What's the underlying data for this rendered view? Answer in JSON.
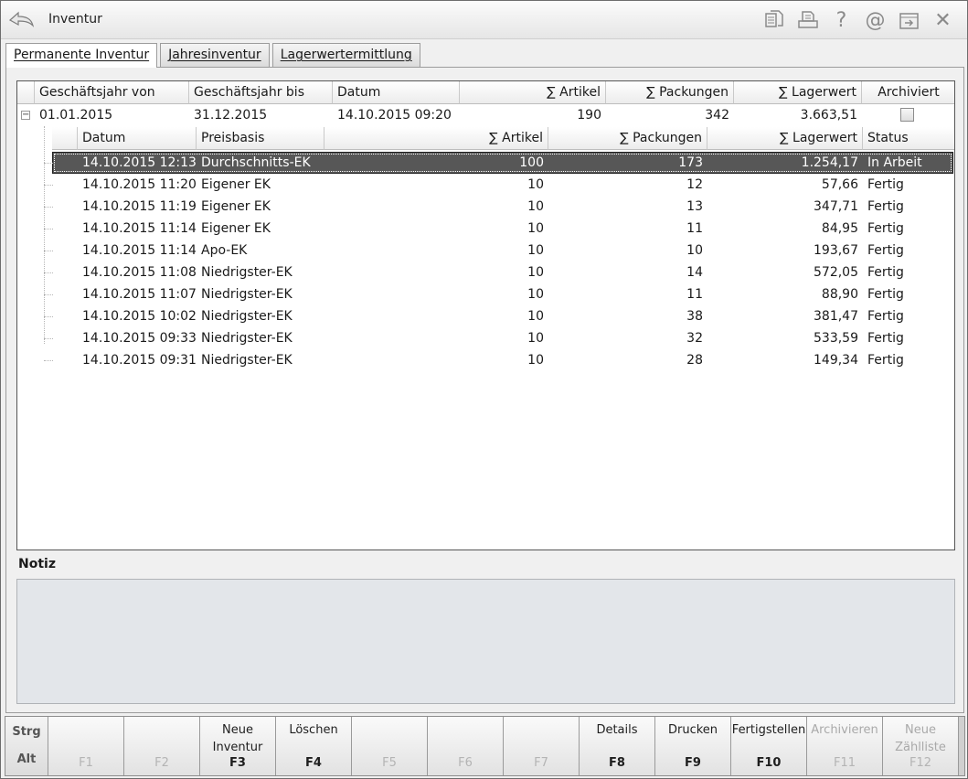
{
  "window": {
    "title": "Inventur"
  },
  "toolbar": {
    "icons": [
      "copy-icon",
      "print-icon",
      "help-icon",
      "at-icon",
      "export-icon",
      "close-icon"
    ],
    "help_glyph": "?",
    "at_glyph": "@",
    "close_glyph": "✕"
  },
  "tabs": [
    {
      "label": "Permanente Inventur",
      "active": true
    },
    {
      "label": "Jahresinventur",
      "active": false
    },
    {
      "label": "Lagerwertermittlung",
      "active": false
    }
  ],
  "main_grid": {
    "columns": [
      "Geschäftsjahr von",
      "Geschäftsjahr bis",
      "Datum",
      "∑ Artikel",
      "∑ Packungen",
      "∑ Lagerwert",
      "Archiviert"
    ],
    "row": {
      "expander": "−",
      "von": "01.01.2015",
      "bis": "31.12.2015",
      "datum": "14.10.2015 09:20",
      "artikel": "190",
      "packungen": "342",
      "lagerwert": "3.663,51",
      "archiviert": false
    }
  },
  "sub_grid": {
    "columns": [
      "Datum",
      "Preisbasis",
      "∑ Artikel",
      "∑ Packungen",
      "∑ Lagerwert",
      "Status"
    ],
    "rows": [
      {
        "datum": "14.10.2015 12:13",
        "preisbasis": "Durchschnitts-EK",
        "artikel": "100",
        "packungen": "173",
        "lagerwert": "1.254,17",
        "status": "In Arbeit",
        "selected": true
      },
      {
        "datum": "14.10.2015 11:20",
        "preisbasis": "Eigener EK",
        "artikel": "10",
        "packungen": "12",
        "lagerwert": "57,66",
        "status": "Fertig"
      },
      {
        "datum": "14.10.2015 11:19",
        "preisbasis": "Eigener EK",
        "artikel": "10",
        "packungen": "13",
        "lagerwert": "347,71",
        "status": "Fertig"
      },
      {
        "datum": "14.10.2015 11:14",
        "preisbasis": "Eigener EK",
        "artikel": "10",
        "packungen": "11",
        "lagerwert": "84,95",
        "status": "Fertig"
      },
      {
        "datum": "14.10.2015 11:14",
        "preisbasis": "Apo-EK",
        "artikel": "10",
        "packungen": "10",
        "lagerwert": "193,67",
        "status": "Fertig"
      },
      {
        "datum": "14.10.2015 11:08",
        "preisbasis": "Niedrigster-EK",
        "artikel": "10",
        "packungen": "14",
        "lagerwert": "572,05",
        "status": "Fertig"
      },
      {
        "datum": "14.10.2015 11:07",
        "preisbasis": "Niedrigster-EK",
        "artikel": "10",
        "packungen": "11",
        "lagerwert": "88,90",
        "status": "Fertig"
      },
      {
        "datum": "14.10.2015 10:02",
        "preisbasis": "Niedrigster-EK",
        "artikel": "10",
        "packungen": "38",
        "lagerwert": "381,47",
        "status": "Fertig"
      },
      {
        "datum": "14.10.2015 09:33",
        "preisbasis": "Niedrigster-EK",
        "artikel": "10",
        "packungen": "32",
        "lagerwert": "533,59",
        "status": "Fertig"
      },
      {
        "datum": "14.10.2015 09:31",
        "preisbasis": "Niedrigster-EK",
        "artikel": "10",
        "packungen": "28",
        "lagerwert": "149,34",
        "status": "Fertig"
      }
    ]
  },
  "notiz": {
    "label": "Notiz",
    "value": ""
  },
  "fkeys": {
    "modifier": {
      "line1": "Strg",
      "line2": "Alt"
    },
    "keys": [
      {
        "key": "F1",
        "label": "",
        "enabled": false
      },
      {
        "key": "F2",
        "label": "",
        "enabled": false
      },
      {
        "key": "F3",
        "label": "Neue\nInventur",
        "enabled": true
      },
      {
        "key": "F4",
        "label": "Löschen",
        "enabled": true
      },
      {
        "key": "F5",
        "label": "",
        "enabled": false
      },
      {
        "key": "F6",
        "label": "",
        "enabled": false
      },
      {
        "key": "F7",
        "label": "",
        "enabled": false
      },
      {
        "key": "F8",
        "label": "Details",
        "enabled": true
      },
      {
        "key": "F9",
        "label": "Drucken",
        "enabled": true
      },
      {
        "key": "F10",
        "label": "Fertigstellen",
        "enabled": true
      },
      {
        "key": "F11",
        "label": "Archivieren",
        "enabled": false
      },
      {
        "key": "F12",
        "label": "Neue\nZählliste",
        "enabled": false
      }
    ]
  }
}
